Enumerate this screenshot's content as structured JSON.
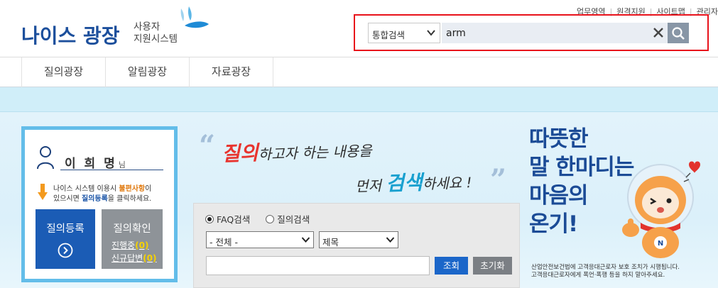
{
  "header": {
    "logo_main": "나이스 광장",
    "logo_sub_line1": "사용자",
    "logo_sub_line2": "지원시스템",
    "util_links": [
      "업무영역",
      "원격지원",
      "사이트맵",
      "관리자"
    ]
  },
  "search": {
    "scope_selected": "통합검색",
    "query": "arm"
  },
  "nav": {
    "items": [
      "질의광장",
      "알림광장",
      "자료광장"
    ]
  },
  "user": {
    "name": "이 희 명",
    "honorific": "님",
    "notice_part1": "나이스 시스템 이용시 ",
    "notice_hl1": "불편사항",
    "notice_part2": "이",
    "notice_part3": "있으시면 ",
    "notice_hl2": "질의등록",
    "notice_part4": "을 클릭하세요.",
    "register_label": "질의등록",
    "check_label": "질의확인",
    "in_progress_label": "진행중",
    "in_progress_count": "(0)",
    "new_answer_label": "신규답변",
    "new_answer_count": "(0)"
  },
  "slogan": {
    "l1_big": "질의",
    "l1_rest": "하고자 하는 내용을",
    "l2_pre": "먼저 ",
    "l2_big": "검색",
    "l2_rest": "하세요 !"
  },
  "faq": {
    "radio_faq": "FAQ검색",
    "radio_question": "질의검색",
    "category_selected": "- 전체 -",
    "field_selected": "제목",
    "search_button": "조회",
    "reset_button": "초기화"
  },
  "promo": {
    "line1": "따뜻한",
    "line2": "말 한마디는",
    "line3": "마음의",
    "line4": "온기!",
    "notice_line1": "산업안전보건법에 고객응대근로자 보호 조치가 시행됩니다.",
    "notice_line2": "고객응대근로자에게 폭언·폭행 등을 하지 말아주세요."
  },
  "colors": {
    "brand_blue": "#1c4f9c",
    "highlight_red": "#e8121b",
    "panel_border": "#63bde9",
    "register_blue": "#1b5cb5"
  }
}
